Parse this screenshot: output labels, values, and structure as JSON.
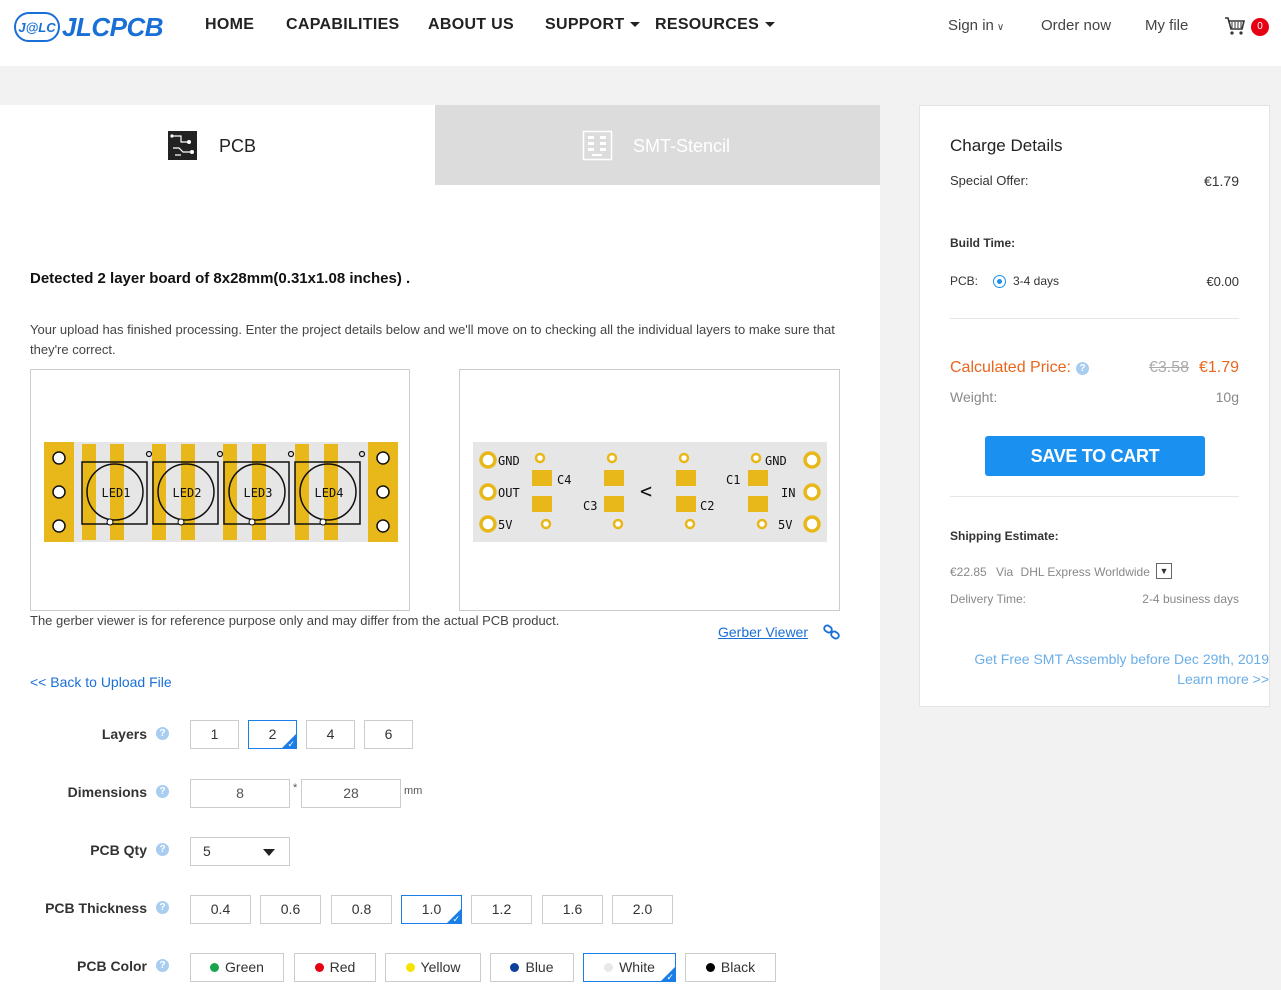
{
  "header": {
    "logo_badge": "J@LC",
    "logo_text": "JLCPCB",
    "nav": [
      "HOME",
      "CAPABILITIES",
      "ABOUT US",
      "SUPPORT",
      "RESOURCES"
    ],
    "sign_in": "Sign in",
    "order_now": "Order now",
    "my_file": "My file",
    "cart_count": "0"
  },
  "tabs": {
    "pcb": "PCB",
    "smt": "SMT-Stencil"
  },
  "main": {
    "detected": "Detected 2 layer board of 8x28mm(0.31x1.08 inches) .",
    "upload_msg": "Your upload has finished processing. Enter the project details below and we'll move on to checking all the individual layers to make sure that they're correct.",
    "gerber_note": "The gerber viewer is for reference purpose only and may differ from the actual PCB product.",
    "gerber_link": "Gerber Viewer",
    "back_link": "<< Back to Upload File"
  },
  "board_top": {
    "labels": [
      "LED1",
      "LED2",
      "LED3",
      "LED4"
    ]
  },
  "board_bottom": {
    "labels": [
      "GND",
      "OUT",
      "5V",
      "C4",
      "C3",
      "<",
      "C1",
      "C2",
      "GND",
      "IN",
      "5V"
    ]
  },
  "form": {
    "layers": {
      "label": "Layers",
      "options": [
        "1",
        "2",
        "4",
        "6"
      ],
      "selected": "2"
    },
    "dimensions": {
      "label": "Dimensions",
      "width": "8",
      "sep": "*",
      "height": "28",
      "unit": "mm"
    },
    "qty": {
      "label": "PCB Qty",
      "value": "5"
    },
    "thickness": {
      "label": "PCB Thickness",
      "options": [
        "0.4",
        "0.6",
        "0.8",
        "1.0",
        "1.2",
        "1.6",
        "2.0"
      ],
      "selected": "1.0"
    },
    "color": {
      "label": "PCB Color",
      "options": [
        {
          "name": "Green",
          "color": "#1aa34a"
        },
        {
          "name": "Red",
          "color": "#e60012"
        },
        {
          "name": "Yellow",
          "color": "#f5e400"
        },
        {
          "name": "Blue",
          "color": "#0a3f9c"
        },
        {
          "name": "White",
          "color": "#e8e8e8"
        },
        {
          "name": "Black",
          "color": "#000000"
        }
      ],
      "selected": "White"
    }
  },
  "side": {
    "title": "Charge Details",
    "special_offer_label": "Special Offer:",
    "special_offer_value": "€1.79",
    "build_time_label": "Build Time:",
    "pcb_label": "PCB:",
    "build_option": "3-4 days",
    "build_price": "€0.00",
    "calc_label": "Calculated Price:",
    "old_price": "€3.58",
    "new_price": "€1.79",
    "weight_label": "Weight:",
    "weight_value": "10g",
    "save_button": "SAVE TO CART",
    "shipping_label": "Shipping Estimate:",
    "shipping_price": "€22.85",
    "shipping_via": "Via",
    "shipping_carrier": "DHL Express Worldwide",
    "delivery_label": "Delivery Time:",
    "delivery_value": "2-4 business days",
    "promo": "Get Free SMT Assembly before Dec 29th, 2019",
    "learn_more": "Learn more >>"
  },
  "colors": {
    "accent": "#1a90f0",
    "link": "#1a6fd6",
    "price": "#e8661e",
    "pad": "#e8b81a"
  }
}
